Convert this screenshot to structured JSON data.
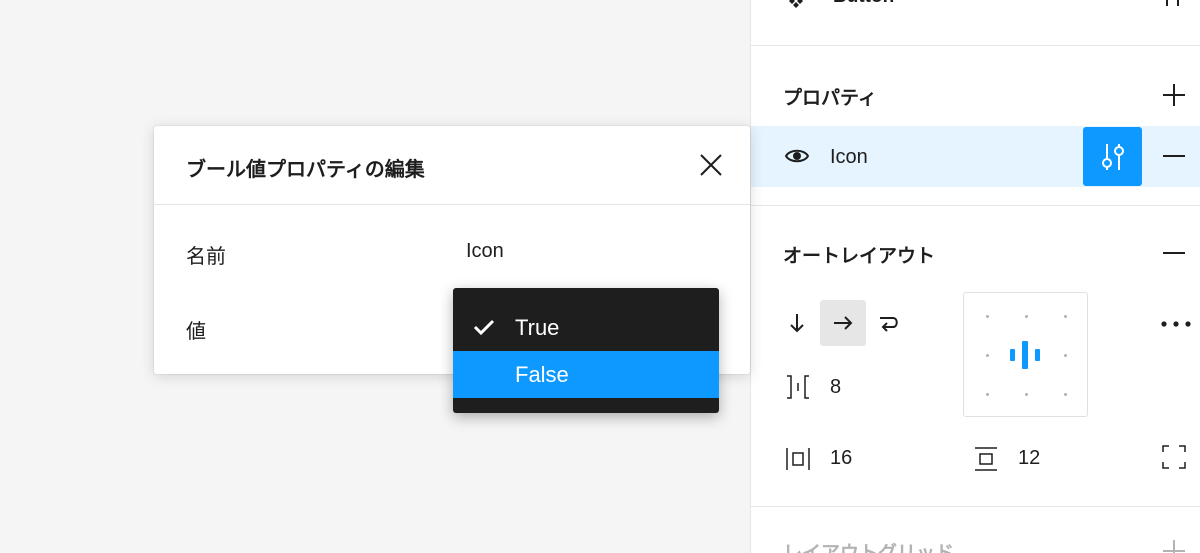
{
  "panel": {
    "component": {
      "name": "Button",
      "icon": "component-icon",
      "action_icon": "adjust-icon"
    },
    "properties": {
      "title": "プロパティ",
      "add_icon": "plus-icon",
      "items": [
        {
          "name": "Icon",
          "type_icon": "eye-icon",
          "edit_icon": "sliders-icon",
          "remove_icon": "minus-icon"
        }
      ]
    },
    "auto_layout": {
      "title": "オートレイアウト",
      "remove_icon": "minus-icon",
      "directions": [
        {
          "icon": "arrow-down-icon",
          "active": false
        },
        {
          "icon": "arrow-right-icon",
          "active": true
        },
        {
          "icon": "wrap-icon",
          "active": false
        }
      ],
      "gap": "8",
      "horizontal_padding": "16",
      "vertical_padding": "12"
    },
    "layout_grid": {
      "title": "レイアウトグリッド",
      "add_icon": "plus-icon"
    }
  },
  "modal": {
    "title": "ブール値プロパティの編集",
    "close_icon": "close-icon",
    "fields": {
      "name_label": "名前",
      "name_value": "Icon",
      "value_label": "値"
    }
  },
  "dropdown": {
    "options": [
      {
        "label": "True",
        "selected": true,
        "highlighted": false
      },
      {
        "label": "False",
        "selected": false,
        "highlighted": true
      }
    ]
  },
  "colors": {
    "accent": "#0d99ff",
    "selected_row_bg": "#e5f4ff",
    "dropdown_bg": "#1e1e1e",
    "canvas_bg": "#f5f5f5"
  }
}
